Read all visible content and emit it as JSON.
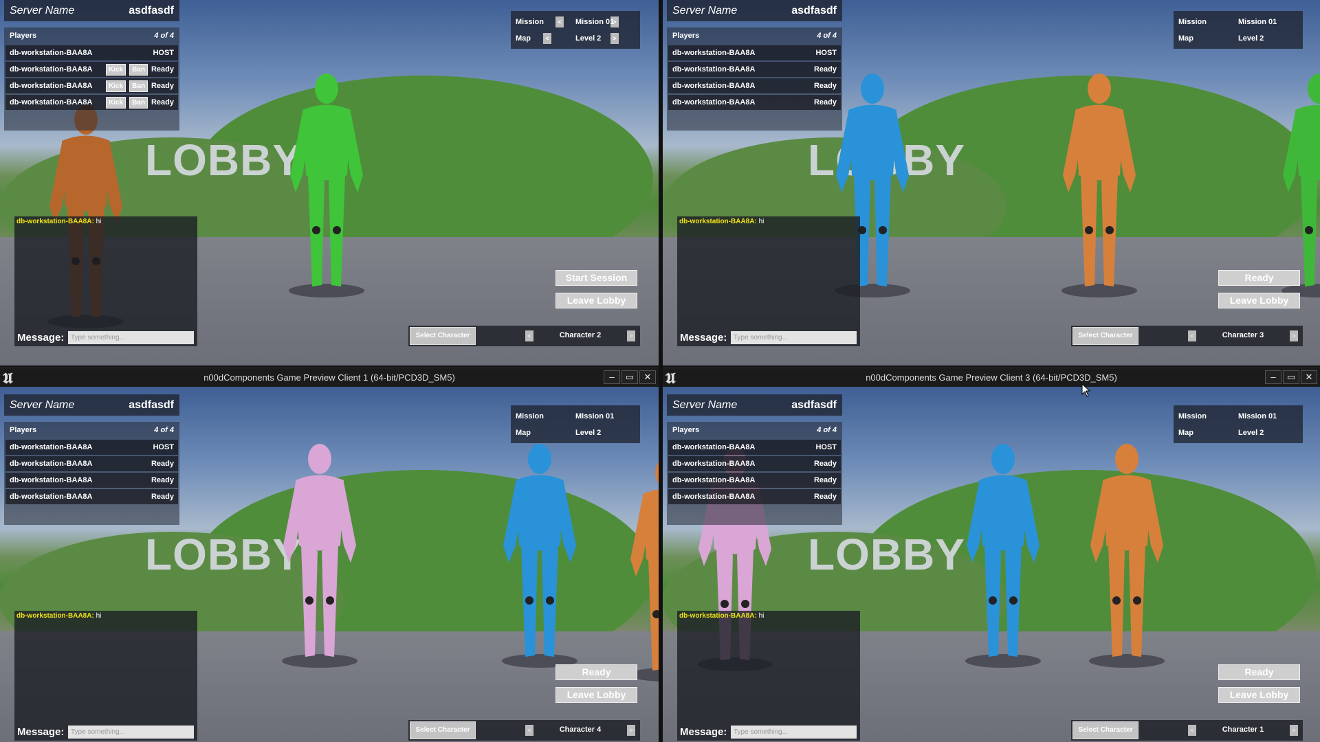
{
  "cursor": "arrow-cursor",
  "colors": {
    "chat_name": "#f2e41a",
    "button_bg": "#cfcfcf",
    "panel_bg": "#1e222c"
  },
  "panes": [
    {
      "title": "",
      "server_label": "Server Name",
      "server_value": "asdfasdf",
      "players_label": "Players",
      "players_count": "4 of 4",
      "players": [
        {
          "name": "db-workstation-BAA8A",
          "status": "HOST",
          "kick": "",
          "ban": ""
        },
        {
          "name": "db-workstation-BAA8A",
          "status": "Ready",
          "kick": "Kick",
          "ban": "Ban"
        },
        {
          "name": "db-workstation-BAA8A",
          "status": "Ready",
          "kick": "Kick",
          "ban": "Ban"
        },
        {
          "name": "db-workstation-BAA8A",
          "status": "Ready",
          "kick": "Kick",
          "ban": "Ban"
        }
      ],
      "mission_label": "Mission",
      "mission_value": "Mission 01",
      "map_label": "Map",
      "map_value": "Level 2",
      "arrows": true,
      "lobby_text": "LOBBY",
      "chat_name": "db-workstation-BAA8A:",
      "chat_text": "hi",
      "message_label": "Message:",
      "message_placeholder": "Type something...",
      "primary_button": "Start Session",
      "leave_button": "Leave Lobby",
      "select_button": "Select Character",
      "character": "Character 2"
    },
    {
      "title": "",
      "server_label": "Server Name",
      "server_value": "asdfasdf",
      "players_label": "Players",
      "players_count": "4 of 4",
      "players": [
        {
          "name": "db-workstation-BAA8A",
          "status": "HOST"
        },
        {
          "name": "db-workstation-BAA8A",
          "status": "Ready"
        },
        {
          "name": "db-workstation-BAA8A",
          "status": "Ready"
        },
        {
          "name": "db-workstation-BAA8A",
          "status": "Ready"
        }
      ],
      "mission_label": "Mission",
      "mission_value": "Mission 01",
      "map_label": "Map",
      "map_value": "Level 2",
      "arrows": false,
      "lobby_text": "LOBBY",
      "chat_name": "db-workstation-BAA8A:",
      "chat_text": "hi",
      "message_label": "Message:",
      "message_placeholder": "Type something...",
      "primary_button": "Ready",
      "leave_button": "Leave Lobby",
      "select_button": "Select Character",
      "character": "Character 3"
    },
    {
      "title": "n00dComponents Game Preview Client 1 (64-bit/PCD3D_SM5)",
      "server_label": "Server Name",
      "server_value": "asdfasdf",
      "players_label": "Players",
      "players_count": "4 of 4",
      "players": [
        {
          "name": "db-workstation-BAA8A",
          "status": "HOST"
        },
        {
          "name": "db-workstation-BAA8A",
          "status": "Ready"
        },
        {
          "name": "db-workstation-BAA8A",
          "status": "Ready"
        },
        {
          "name": "db-workstation-BAA8A",
          "status": "Ready"
        }
      ],
      "mission_label": "Mission",
      "mission_value": "Mission 01",
      "map_label": "Map",
      "map_value": "Level 2",
      "arrows": false,
      "lobby_text": "LOBBY",
      "chat_name": "db-workstation-BAA8A:",
      "chat_text": "hi",
      "message_label": "Message:",
      "message_placeholder": "Type something...",
      "primary_button": "Ready",
      "leave_button": "Leave Lobby",
      "select_button": "Select Character",
      "character": "Character 4"
    },
    {
      "title": "n00dComponents Game Preview Client 3 (64-bit/PCD3D_SM5)",
      "server_label": "Server Name",
      "server_value": "asdfasdf",
      "players_label": "Players",
      "players_count": "4 of 4",
      "players": [
        {
          "name": "db-workstation-BAA8A",
          "status": "HOST"
        },
        {
          "name": "db-workstation-BAA8A",
          "status": "Ready"
        },
        {
          "name": "db-workstation-BAA8A",
          "status": "Ready"
        },
        {
          "name": "db-workstation-BAA8A",
          "status": "Ready"
        }
      ],
      "mission_label": "Mission",
      "mission_value": "Mission 01",
      "map_label": "Map",
      "map_value": "Level 2",
      "arrows": false,
      "lobby_text": "LOBBY",
      "chat_name": "db-workstation-BAA8A:",
      "chat_text": "hi",
      "message_label": "Message:",
      "message_placeholder": "Type something...",
      "primary_button": "Ready",
      "leave_button": "Leave Lobby",
      "select_button": "Select Character",
      "character": "Character 1"
    }
  ],
  "window_controls": {
    "minimize": "‒",
    "maximize": "▭",
    "close": "✕"
  },
  "logo_glyph": "U"
}
